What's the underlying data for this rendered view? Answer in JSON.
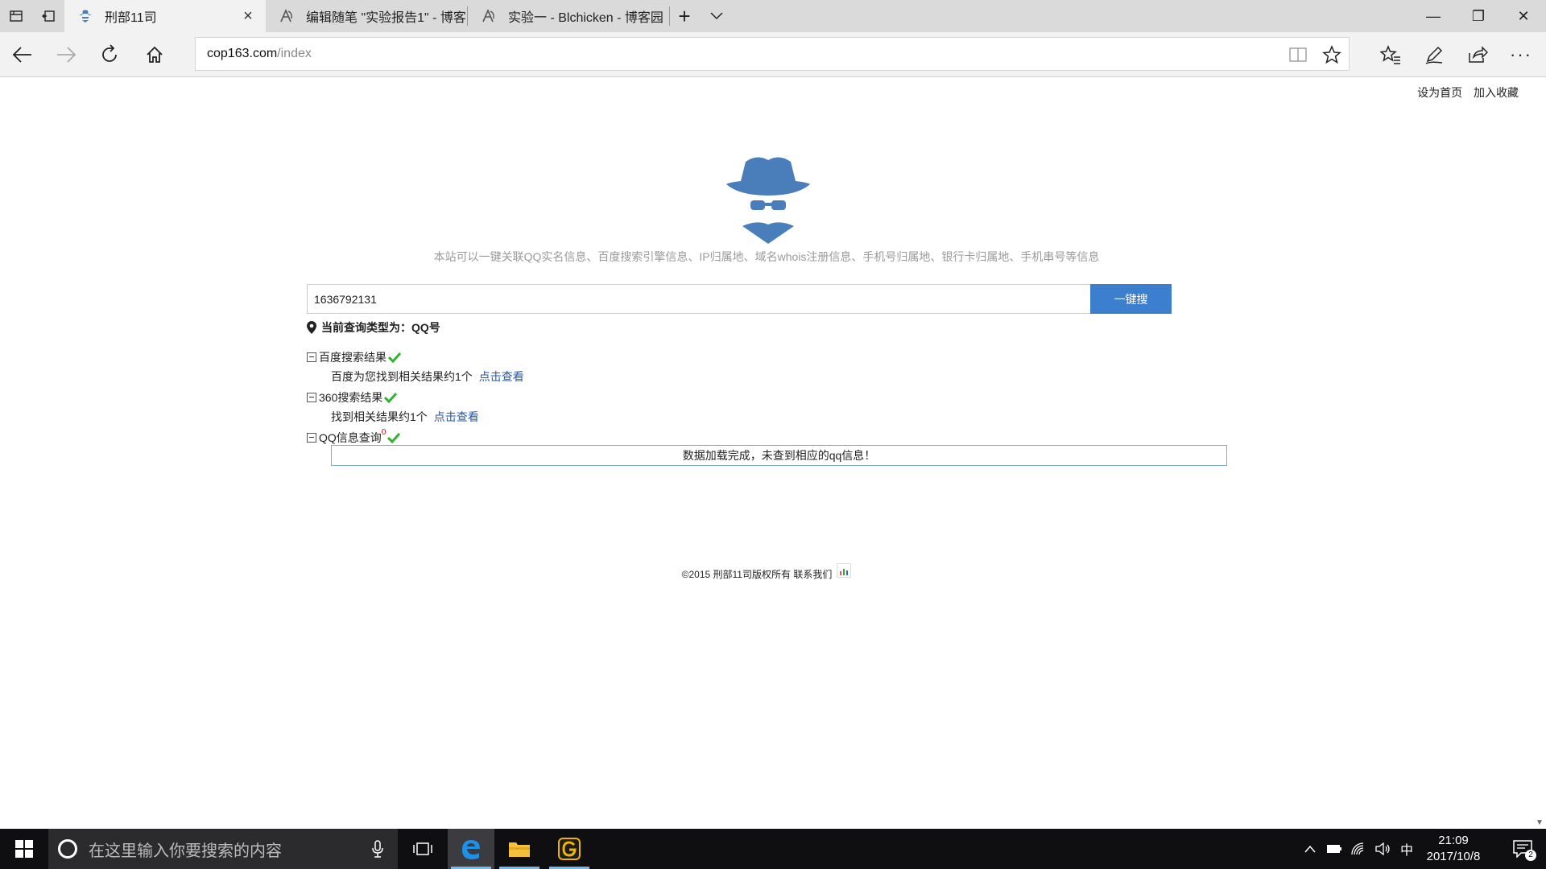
{
  "browser": {
    "tabs": [
      {
        "title": "刑部11司",
        "active": true
      },
      {
        "title": "编辑随笔 \"实验报告1\" - 博客",
        "active": false
      },
      {
        "title": "实验一 - Blchicken - 博客园",
        "active": false
      }
    ],
    "new_tab_glyph": "+",
    "tab_list_glyph": "⌄",
    "window_controls": {
      "minimize": "—",
      "restore": "❐",
      "close": "✕"
    },
    "address": {
      "host": "cop163.com",
      "path": "/index"
    }
  },
  "page": {
    "top_links": {
      "set_homepage": "设为首页",
      "add_favorite": "加入收藏"
    },
    "intro": "本站可以一键关联QQ实名信息、百度搜索引擎信息、IP归属地、域名whois注册信息、手机号归属地、银行卡归属地、手机串号等信息",
    "search": {
      "value": "1636792131",
      "button": "一键搜"
    },
    "query_type": "当前查询类型为：QQ号",
    "results": [
      {
        "title": "百度搜索结果",
        "body": "百度为您找到相关结果约1个",
        "link": "点击查看"
      },
      {
        "title": "360搜索结果",
        "body": "找到相关结果约1个",
        "link": "点击查看"
      },
      {
        "title": "QQ信息查询",
        "superscript": "0",
        "message": "数据加载完成，未查到相应的qq信息！"
      }
    ],
    "footer": {
      "copyright": "©2015 刑部11司版权所有",
      "contact": "联系我们"
    },
    "colors": {
      "accent": "#3d7fcf",
      "logo": "#4a7ebb",
      "check": "#2db52d",
      "link": "#1a5bb5"
    }
  },
  "taskbar": {
    "search_placeholder": "在这里输入你要搜索的内容",
    "ime": "中",
    "time": "21:09",
    "date": "2017/10/8",
    "notification_count": "2"
  }
}
